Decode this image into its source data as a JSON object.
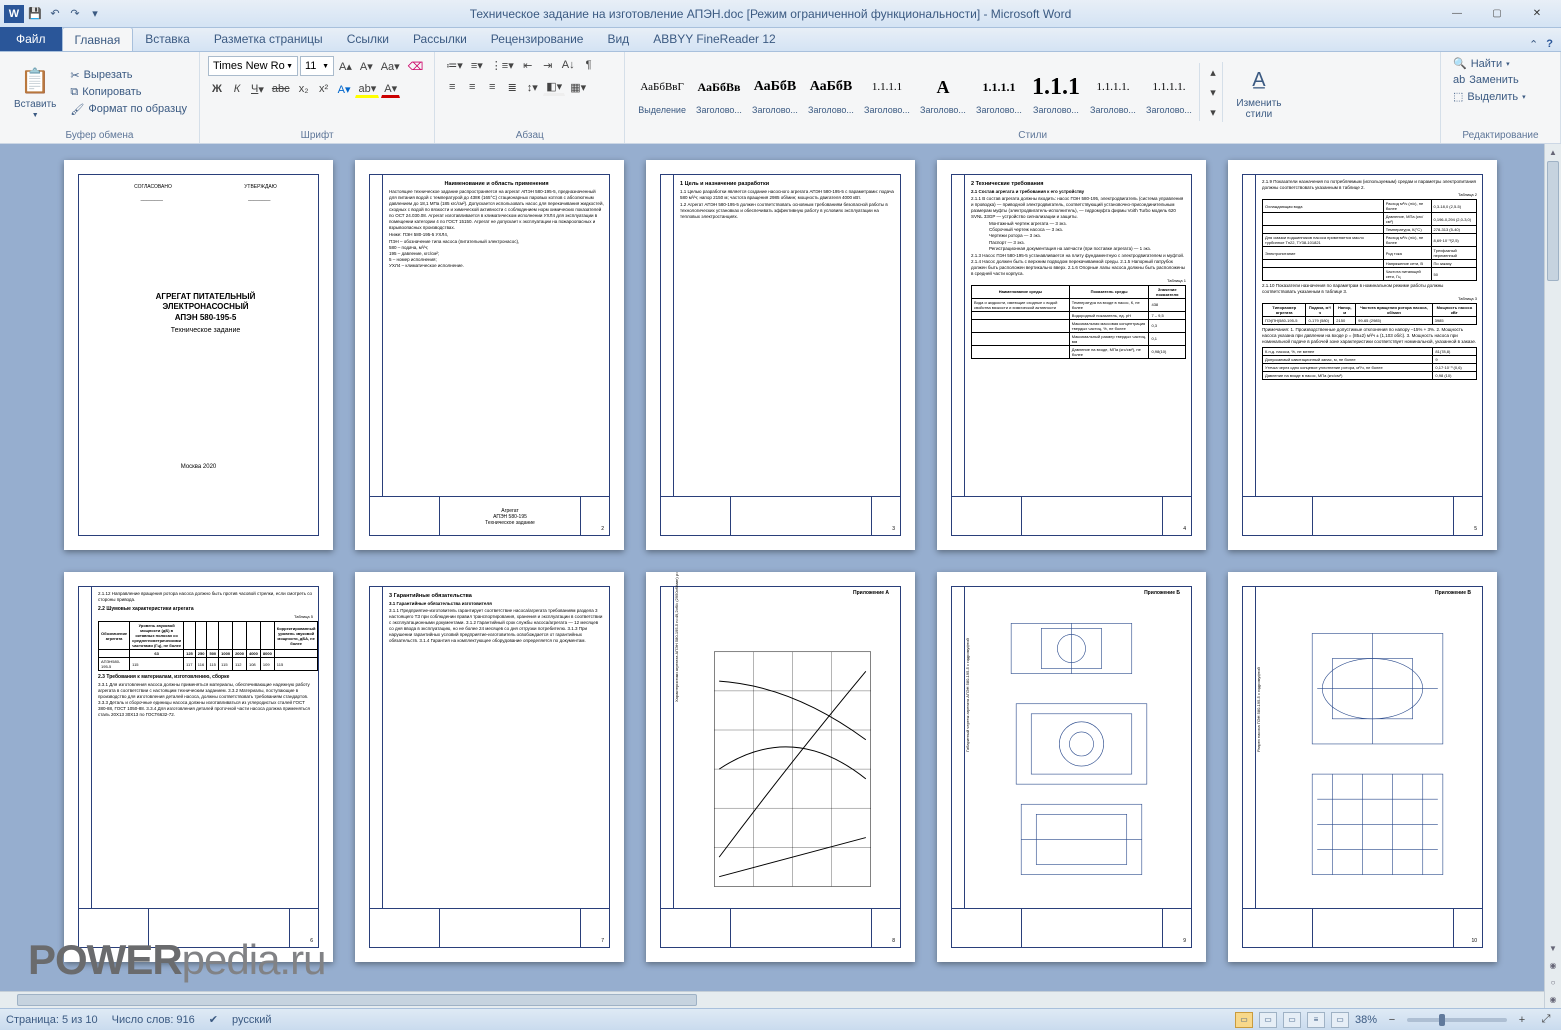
{
  "titlebar": {
    "title": "Техническое задание на изготовление АПЭН.doc  [Режим ограниченной функциональности]  -  Microsoft Word"
  },
  "tabs": {
    "file": "Файл",
    "items": [
      "Главная",
      "Вставка",
      "Разметка страницы",
      "Ссылки",
      "Рассылки",
      "Рецензирование",
      "Вид",
      "ABBYY FineReader 12"
    ],
    "active": 0
  },
  "ribbon": {
    "clipboard": {
      "label": "Буфер обмена",
      "paste": "Вставить",
      "cut": "Вырезать",
      "copy": "Копировать",
      "format_painter": "Формат по образцу"
    },
    "font": {
      "label": "Шрифт",
      "family": "Times New Ro",
      "size": "11"
    },
    "paragraph": {
      "label": "Абзац"
    },
    "styles": {
      "label": "Стили",
      "items": [
        {
          "preview": "АаБбВвГ",
          "name": "Выделение",
          "cls": ""
        },
        {
          "preview": "АаБбВв",
          "name": "Заголово...",
          "cls": "h3"
        },
        {
          "preview": "АаБбВ",
          "name": "Заголово...",
          "cls": "h2"
        },
        {
          "preview": "АаБбВ",
          "name": "Заголово...",
          "cls": "h2"
        },
        {
          "preview": "1.1.1.1",
          "name": "Заголово...",
          "cls": ""
        },
        {
          "preview": "А",
          "name": "Заголово...",
          "cls": "h1"
        },
        {
          "preview": "1.1.1.1",
          "name": "Заголово...",
          "cls": "h3"
        },
        {
          "preview": "1.1.1",
          "name": "Заголово...",
          "cls": "h1"
        },
        {
          "preview": "1.1.1.1.",
          "name": "Заголово...",
          "cls": ""
        },
        {
          "preview": "1.1.1.1.",
          "name": "Заголово...",
          "cls": ""
        }
      ],
      "change": "Изменить стили"
    },
    "editing": {
      "label": "Редактирование",
      "find": "Найти",
      "replace": "Заменить",
      "select": "Выделить"
    }
  },
  "pages": {
    "p1": {
      "agree_l": "СОГЛАСОВАНО",
      "agree_r": "УТВЕРЖДАЮ",
      "t1": "АГРЕГАТ ПИТАТЕЛЬНЫЙ",
      "t2": "ЭЛЕКТРОНАСОСНЫЙ",
      "t3": "АПЭН 580-195-5",
      "sub": "Техническое задание",
      "city": "Москва 2020"
    },
    "p2": {
      "h": "Наименование и область применения",
      "body": "Настоящее техническое задание распространяется на агрегат АПЭН 580-195-5, предназначенный для питания водой с температурой до 438К (165°С) стационарных паровых котлов с абсолютным давлением до 18,1 МПа (185 кгс/см²). Допускается использовать насос для перекачивания жидкостей, сходных с водой по вязкости и химической активности с соблюдением норм химических показателей по ОСТ 24.030.08. Агрегат изготавливается в климатическом исполнении УХЛ4 для эксплуатации в помещении категории 4 по ГОСТ 15150. Агрегат не допускает к эксплуатации на пожароопасных и взрывоопасных производствах.",
      "codes": "Ниже: ПЭН 580-195-5 УХЛ4,\nПЭН – обозначение типа насоса (питательный электронасос),\n580 – подача, м³/ч;\n195 – давление, кгс/см²;\n5 – номер исполнения;\nУХЛ4 – климатическое исполнение.",
      "tb1": "Агрегат",
      "tb2": "АПЭН 580-195",
      "tb3": "Техническое задание"
    },
    "p3": {
      "h": "1  Цель и назначение разработки",
      "p1": "1.1 Целью разработки является создание насосного агрегата АПЭН 580-195-5 с параметрами: подача 580 м³/ч; напор 2150 м; частота вращения 2985 об/мин; мощность двигателя 4000 кВт.",
      "p2": "1.2 Агрегат АПЭН 580-195-5 должен соответствовать основным требованиям безопасной работы в технологических установках и обеспечивать эффективную работу в условиях эксплуатации на тепловых электростанциях."
    },
    "p4": {
      "h": "2  Технические требования",
      "sh": "2.1 Состав агрегата и требования к его устройству",
      "para": "2.1.1 В состав агрегата должны входить: насос ПЭН 580-195, электродвигатель (система управления и проводка) — приводной электродвигатель, соответствующий установочно-присоединительным размерам муфты (электродвигатель-исполнитель), — гидромуфта фирмы Voith Turbo модель 620 SVNL 33GP — устройство сигнализации и защиты.",
      "list": "Монтажный чертеж агрегата — 3 экз.\nСборочный чертеж насоса — 3 экз.\nЧертежи ротора — 3 экз.\nПаспорт — 3 экз.\nРегистрационная документация на запчасти (при поставке агрегата) — 1 экз.",
      "para2": "2.1.3 Насос ПЭН 580-195-5 устанавливается на плиту фундаментную с электродвигателем и муфтой. 2.1.4 Насос должен быть с верхним подводом перекачиваемой среды. 2.1.5 Напорный патрубок должен быть расположен вертикально вверх. 2.1.6 Опорные лапы насоса должны быть расположены в средней части корпуса.",
      "table1_cap": "Таблица 1",
      "table1": {
        "headers": [
          "Наименование среды",
          "Показатель среды",
          "Значение показателя"
        ],
        "rows": [
          [
            "Вода и жидкости, имеющие сходные с водой свойства вязкости и химической активности",
            "Температура на входе в насос, К, не более",
            "438"
          ],
          [
            "",
            "Водородный показатель, ед. pH",
            "7 – 9,5"
          ],
          [
            "",
            "Максимальная массовая концентрация твердых частиц, %, не более",
            "0,3"
          ],
          [
            "",
            "Максимальный размер твердых частиц, мм",
            "0,1"
          ],
          [
            "",
            "Давление на входе, МПа (кгс/см²), не более",
            "0,98(10)"
          ]
        ]
      }
    },
    "p5": {
      "para": "2.1.9 Показатели назначения по потребляемым (используемым) средам и параметры электропитания должны соответствовать указанным в таблице 2.",
      "t2cap": "Таблица 2",
      "t2": {
        "rows": [
          [
            "Охлаждающая вода",
            "Расход м³/ч (л/с), не более",
            "0,3-18,0 (2,5-5)"
          ],
          [
            "",
            "Давление, МПа (кгс/см²)",
            "0,196-0,294 (2,0-3,0)"
          ],
          [
            "",
            "Температура, К(°С)",
            "278-313 (5-40)"
          ],
          [
            "Для смазки подшипников насоса применяется масло турбинное Тп22, ТУ38-101821",
            "Расход м³/ч (л/с), не более",
            "8,69·10⁻³(2,5)"
          ],
          [
            "Электропитание",
            "Род тока",
            "Трехфазный переменный"
          ],
          [
            "",
            "Напряжение сети, В",
            "По заказу"
          ],
          [
            "",
            "Частота питающей сети, Гц",
            "50"
          ]
        ]
      },
      "para2": "2.1.10 Показатели назначения по параметрам в номинальном режиме работы должны соответствовать указанным в таблице 3.",
      "t3cap": "Таблица 3",
      "t3": {
        "headers": [
          "Типоразмер агрегата",
          "Подача, м³/ч",
          "Напор, м",
          "Частота вращения ротора насоса, об/мин",
          "Мощность насоса кВт"
        ],
        "rows": [
          [
            "ПЭ(ПН)580-195-5",
            "0-179 (580)",
            "2150",
            "99-65 (2985)",
            "3985"
          ]
        ]
      },
      "note": "Примечания: 1. Производственные допустимые отклонения по напору –15% + 3%. 2. Мощность насоса указана при давлении на входе р = (85±2) м³/ч ± (1,103 об/с). 3. Мощность насоса при номинальной подаче в рабочей зоне характеристики соответствует номинальной, указанной в заказе.",
      "t4": {
        "rows": [
          [
            "К.п.д. насоса, %, не менее",
            "81(78,8)"
          ],
          [
            "Допускаемый кавитационный запас, м, не более",
            "9"
          ],
          [
            "Утечка через одно концевое уплотнение ротора, м³/ч, не более",
            "0,17·10⁻³ (0,6)"
          ],
          [
            "Давление на входе в насос, МПа (кгс/см²)",
            "0,98 (10)"
          ]
        ]
      }
    },
    "p6": {
      "para": "2.1.12 Направление вращения ротора насоса должно быть против часовой стрелки, если смотреть со стороны привода.",
      "h": "2.2 Шумовые характеристики агрегата",
      "t5cap": "Таблица 5",
      "t5": {
        "headers": [
          "Обозначение агрегата",
          "Уровень звуковой мощности (дБ) в октавных полосах со среднегеометрическими частотами (Гц), не более",
          "",
          "",
          "",
          "",
          "",
          "",
          "",
          "Корректированный уровень звуковой мощности, дБА, не более"
        ],
        "sub": [
          "",
          "63",
          "125",
          "250",
          "500",
          "1000",
          "2000",
          "4000",
          "8000",
          ""
        ],
        "rows": [
          [
            "АПЭН580-195-5",
            "115",
            "117",
            "116",
            "115",
            "115",
            "112",
            "108",
            "109",
            "115"
          ]
        ]
      },
      "h2": "2.3 Требования к материалам, изготовлению, сборке",
      "para2": "3.3.1 Для изготовления насоса должны применяться материалы, обеспечивающие надежную работу агрегата в соответствии с настоящим техническим заданием. 3.3.2 Материалы, поступающие в производство для изготовления деталей насоса, должны соответствовать требованиям стандартов. 3.3.3 Деталь и сборочные единицы насоса должны изготавливаться из углеродистых сталей ГОСТ 380-88, ГОСТ 1050-88. 3.3.4 Для изготовления деталей проточной части насоса должна применяться сталь 20Х13 30Х13 по ГОСТ6632-72."
    },
    "p7": {
      "h": "3  Гарантийные обязательства",
      "sh": "3.1  Гарантийные обязательства изготовителя",
      "para": "3.1.1 Предприятие-изготовитель гарантирует соответствие насоса/агрегата требованиям раздела 3 настоящего ТЗ при соблюдении правил транспортирования, хранения и эксплуатации в соответствии с эксплуатационными документами. 3.1.2 Гарантийный срок службы насоса/агрегата — 12 месяцев со дня ввода в эксплуатацию, но не более 24 месяцев со дня отгрузки потребителю. 3.1.3 При нарушении гарантийных условий предприятие-изготовитель освобождается от гарантийных обязательств. 3.1.4 Гарантия на комплектующее оборудование определяется по документам."
    },
    "p8": {
      "h": "Приложение А",
      "caption": "Характеристики агрегата АПЭН 580-195-5 n=49,2об/с (2950об/мин) ρ=966,5 кг/м³"
    },
    "p9": {
      "h": "Приложение Б",
      "caption": "Габаритный чертеж агрегата АПЭН 580-195-5 с гидромуфтой"
    },
    "p10": {
      "h": "Приложение В",
      "caption": "Разрез насоса ПЭН 580-195-5 с гидромуфтой"
    }
  },
  "watermark": {
    "strong": "POWER",
    "rest": "pedia.ru"
  },
  "status": {
    "page": "Страница: 5 из 10",
    "words": "Число слов: 916",
    "lang": "русский",
    "zoom": "38%"
  }
}
